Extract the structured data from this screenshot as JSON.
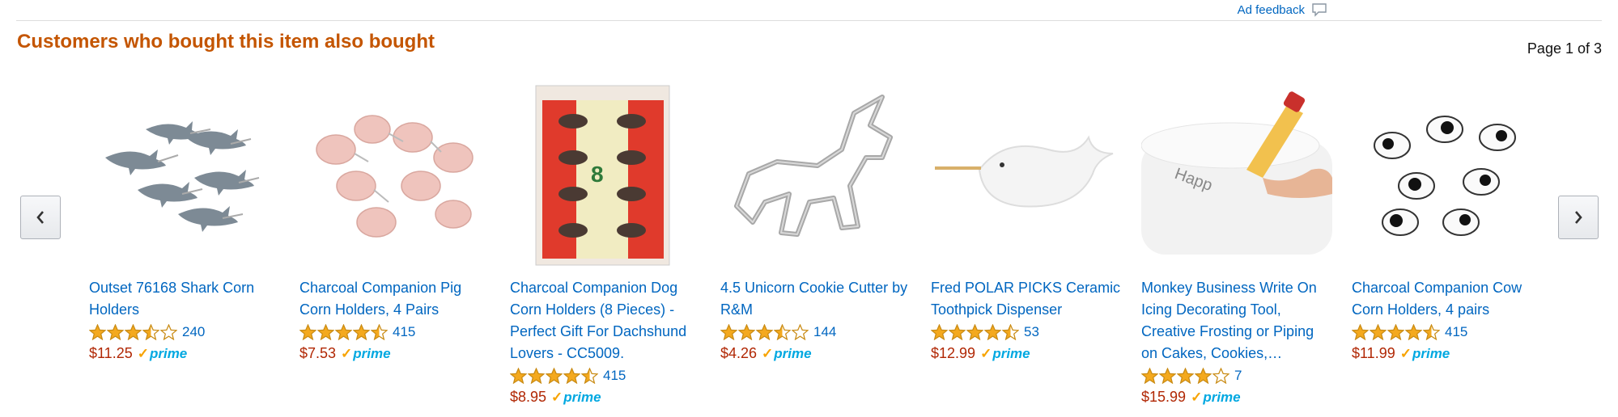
{
  "header": {
    "ad_feedback_label": "Ad feedback",
    "title": "Customers who bought this item also bought",
    "page_info": "Page 1 of 3"
  },
  "colors": {
    "title": "#c45500",
    "link": "#0066c0",
    "price": "#b12704",
    "prime": "#00a8e1",
    "star": "#f4a91e"
  },
  "icons": {
    "prev": "chevron-left-icon",
    "next": "chevron-right-icon",
    "ad_feedback": "speech-bubble-icon",
    "star": "star-icon"
  },
  "products": [
    {
      "title": "Outset 76168 Shark Corn Holders",
      "rating": 3.5,
      "reviews": "240",
      "price": "$11.25",
      "prime_label": "prime"
    },
    {
      "title": "Charcoal Companion Pig Corn Holders, 4 Pairs",
      "rating": 4.5,
      "reviews": "415",
      "price": "$7.53",
      "prime_label": "prime"
    },
    {
      "title": "Charcoal Companion Dog Corn Holders (8 Pieces) - Perfect Gift For Dachshund Lovers - CC5009.",
      "rating": 4.5,
      "reviews": "415",
      "price": "$8.95",
      "prime_label": "prime"
    },
    {
      "title": "4.5 Unicorn Cookie Cutter by R&M",
      "rating": 3.5,
      "reviews": "144",
      "price": "$4.26",
      "prime_label": "prime"
    },
    {
      "title": "Fred POLAR PICKS Ceramic Toothpick Dispenser",
      "rating": 4.5,
      "reviews": "53",
      "price": "$12.99",
      "prime_label": "prime"
    },
    {
      "title": "Monkey Business Write On Icing Decorating Tool, Creative Frosting or Piping on Cakes, Cookies,…",
      "rating": 4,
      "reviews": "7",
      "price": "$15.99",
      "prime_label": "prime"
    },
    {
      "title": "Charcoal Companion Cow Corn Holders, 4 pairs",
      "rating": 4.5,
      "reviews": "415",
      "price": "$11.99",
      "prime_label": "prime"
    }
  ]
}
